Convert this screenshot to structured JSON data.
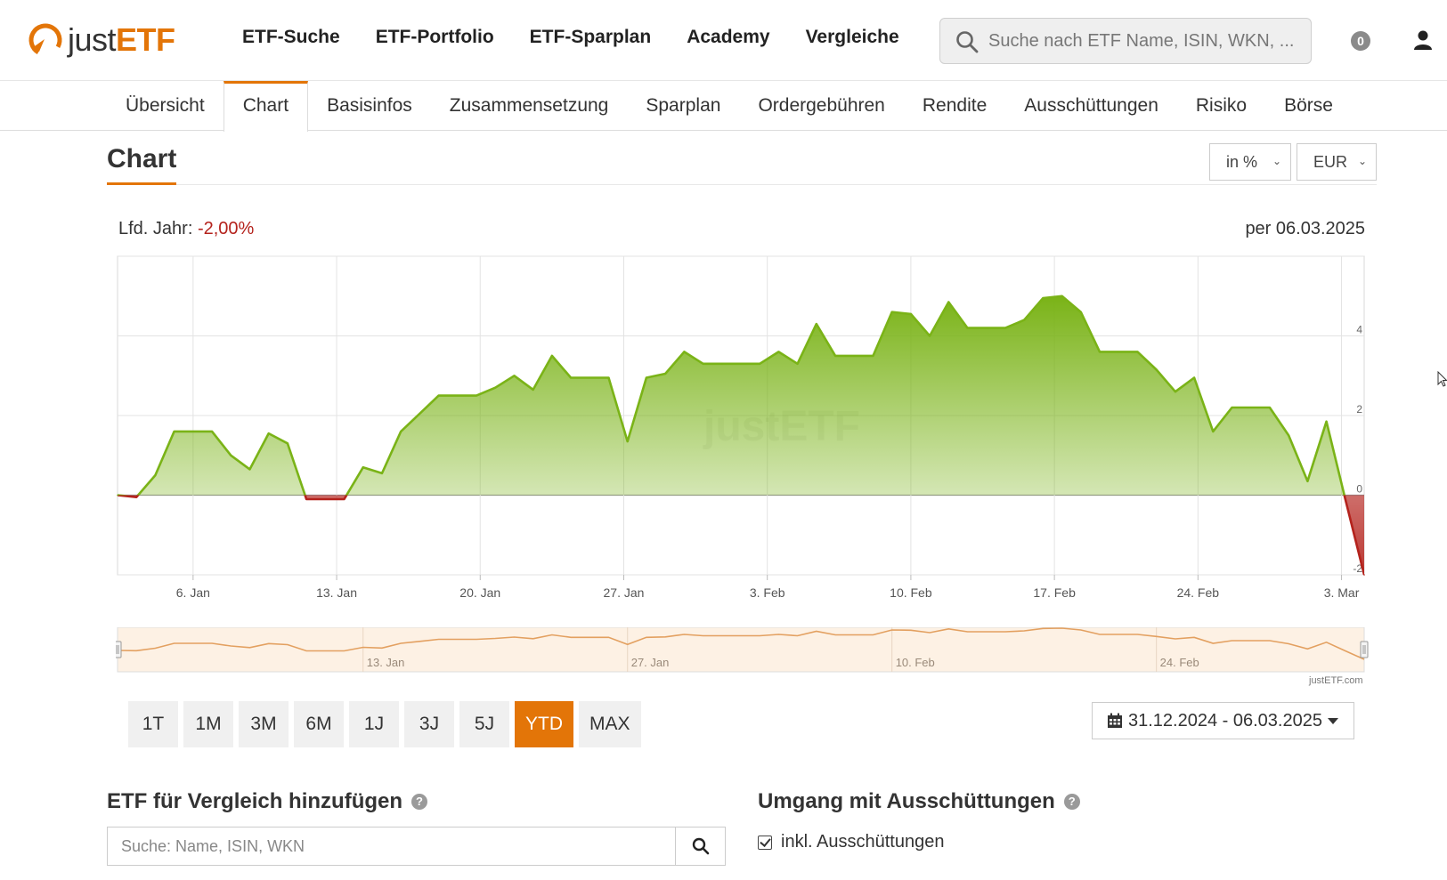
{
  "brand": {
    "name_part1": "just",
    "name_part2": "ETF",
    "accent": "#e37508"
  },
  "nav": {
    "items": [
      "ETF-Suche",
      "ETF-Portfolio",
      "ETF-Sparplan",
      "Academy",
      "Vergleiche"
    ],
    "search_placeholder": "Suche nach ETF Name, ISIN, WKN, ...",
    "watchlist_count": "0"
  },
  "subnav": {
    "tabs": [
      "Übersicht",
      "Chart",
      "Basisinfos",
      "Zusammensetzung",
      "Sparplan",
      "Ordergebühren",
      "Rendite",
      "Ausschüttungen",
      "Risiko",
      "Börse"
    ],
    "active": "Chart"
  },
  "chart_section": {
    "title": "Chart",
    "unit_select": "in %",
    "currency_select": "EUR",
    "ytd_label": "Lfd. Jahr:",
    "ytd_value": "-2,00%",
    "as_of": "per 06.03.2025",
    "credit": "justETF.com",
    "watermark": "justETF"
  },
  "chart_data": {
    "type": "area",
    "x_tick_labels": [
      "6. Jan",
      "13. Jan",
      "20. Jan",
      "27. Jan",
      "3. Feb",
      "10. Feb",
      "17. Feb",
      "24. Feb",
      "3. Mar"
    ],
    "y_tick_labels": [
      "4",
      "2",
      "0",
      "-2"
    ],
    "ylim": [
      -2,
      6
    ],
    "grid": true,
    "series": [
      {
        "values": [
          0.0,
          -0.05,
          0.5,
          1.6,
          1.6,
          1.6,
          1.0,
          0.65,
          1.55,
          1.3,
          -0.1,
          -0.1,
          -0.1,
          0.7,
          0.55,
          1.6,
          2.05,
          2.5,
          2.5,
          2.5,
          2.7,
          3.0,
          2.65,
          3.5,
          2.95,
          2.95,
          2.95,
          1.35,
          2.95,
          3.05,
          3.6,
          3.3,
          3.3,
          3.3,
          3.3,
          3.6,
          3.3,
          4.3,
          3.5,
          3.5,
          3.5,
          4.6,
          4.55,
          4.0,
          4.85,
          4.2,
          4.2,
          4.2,
          4.4,
          4.95,
          5.0,
          4.6,
          3.6,
          3.6,
          3.6,
          3.15,
          2.6,
          2.95,
          1.6,
          2.2,
          2.2,
          2.2,
          1.5,
          0.35,
          1.85,
          -0.1,
          -2.0
        ],
        "up_color": "#7ab317",
        "down_color": "#b4221c"
      }
    ],
    "navigator_labels": [
      "13. Jan",
      "27. Jan",
      "10. Feb",
      "24. Feb"
    ]
  },
  "periods": {
    "buttons": [
      "1T",
      "1M",
      "3M",
      "6M",
      "1J",
      "3J",
      "5J",
      "YTD",
      "MAX"
    ],
    "active": "YTD"
  },
  "date_range": "31.12.2024 - 06.03.2025",
  "compare": {
    "title": "ETF für Vergleich hinzufügen",
    "search_placeholder": "Suche: Name, ISIN, WKN"
  },
  "distributions": {
    "title": "Umgang mit Ausschüttungen",
    "checkbox_label": "inkl. Ausschüttungen"
  }
}
